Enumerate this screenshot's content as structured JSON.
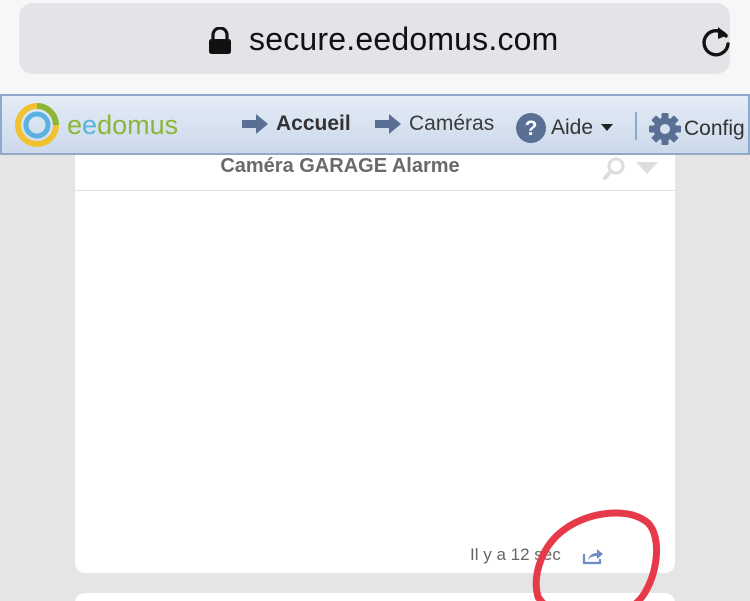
{
  "browser": {
    "url": "secure.eedomus.com",
    "lock_icon": "lock-icon",
    "reload_icon": "reload-icon"
  },
  "navbar": {
    "logo_text_part1": "e",
    "logo_text_part2": "e",
    "logo_text_part3": "domus",
    "items": [
      {
        "label": "Accueil",
        "icon": "arrow-right-icon"
      },
      {
        "label": "Caméras",
        "icon": "arrow-right-icon"
      },
      {
        "label": "Aide",
        "icon": "help-icon"
      },
      {
        "label": "Config",
        "icon": "gear-icon"
      }
    ]
  },
  "camera_card": {
    "title": "Caméra GARAGE Alarme",
    "timestamp": "Il y a 12 sec",
    "share_icon": "share-icon"
  },
  "colors": {
    "nav_border": "#8fa9cc",
    "logo_green": "#8bb63a",
    "logo_blue": "#5ab3df",
    "annotation_red": "#e63a4a"
  }
}
